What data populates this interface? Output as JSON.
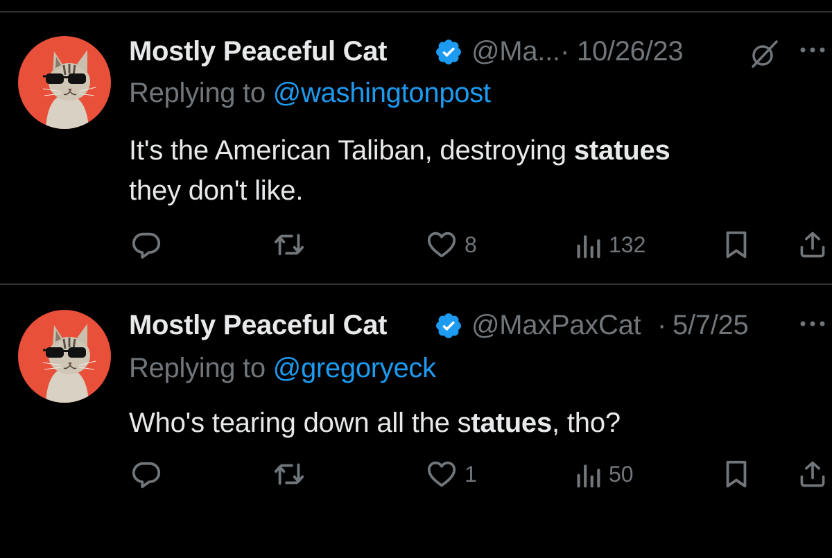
{
  "tweets": [
    {
      "display_name": "Mostly Peaceful Cat",
      "handle": "@Ma...",
      "separator": "·",
      "date": "10/26/23",
      "reply_prefix": "Replying to",
      "reply_to": "@washingtonpost",
      "text_part1": "It's the American Taliban, destroying ",
      "text_bold": "statues",
      "text_part2": " they don't like.",
      "likes": "8",
      "views": "132",
      "icons": [
        "verified-badge-icon",
        "grok-icon",
        "more-icon",
        "reply-icon",
        "retweet-icon",
        "like-icon",
        "views-icon",
        "bookmark-icon",
        "share-icon"
      ]
    },
    {
      "display_name": "Mostly Peaceful Cat",
      "handle": "@MaxPaxCat",
      "separator": "·",
      "date": "5/7/25",
      "reply_prefix": "Replying to",
      "reply_to": "@gregoryeck",
      "text_part1": "Who's tearing down all the s",
      "text_bold": "tatues",
      "text_part2": ", tho?",
      "likes": "1",
      "views": "50",
      "icons": [
        "verified-badge-icon",
        "more-icon",
        "reply-icon",
        "retweet-icon",
        "like-icon",
        "views-icon",
        "bookmark-icon",
        "share-icon"
      ]
    }
  ],
  "colors": {
    "background": "#000000",
    "primary_text": "#e7e9ea",
    "secondary_text": "#71767b",
    "link": "#1d9bf0",
    "divider": "#2f3336",
    "avatar_bg": "#e8503a"
  }
}
